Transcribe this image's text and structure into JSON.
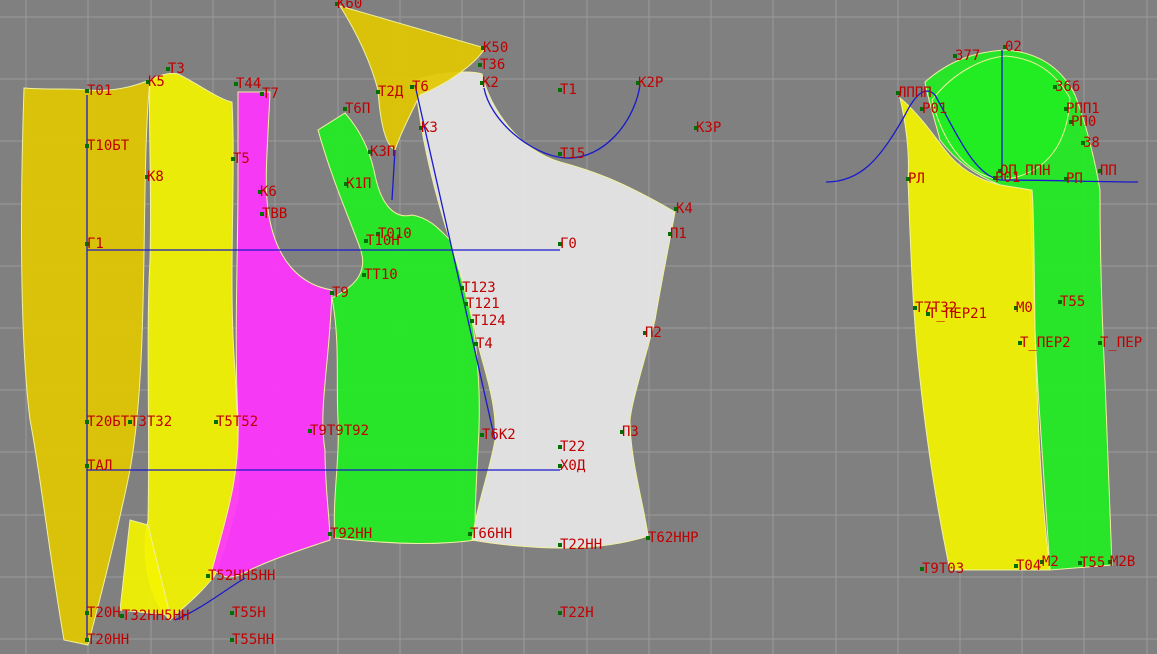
{
  "colors": {
    "background": "#808080",
    "grid": "#9a9a9a",
    "yellow_piece": "#e2c800",
    "bright_yellow_piece": "#f4f400",
    "magenta_piece": "#ff33ff",
    "green_piece": "#22ee22",
    "white_piece": "#e8e8e8",
    "label": "#c00000",
    "point": "#007000",
    "guide_line": "#1a1acc"
  },
  "pieces": [
    {
      "name": "side-back-panel",
      "color": "yellow_piece"
    },
    {
      "name": "back-panel",
      "color": "bright_yellow_piece"
    },
    {
      "name": "side-panel",
      "color": "magenta_piece"
    },
    {
      "name": "front-side-panel",
      "color": "green_piece"
    },
    {
      "name": "front-panel",
      "color": "white_piece"
    },
    {
      "name": "shoulder-yoke",
      "color": "yellow_piece"
    },
    {
      "name": "sleeve-under",
      "color": "bright_yellow_piece"
    },
    {
      "name": "sleeve-upper",
      "color": "green_piece"
    }
  ],
  "labels": [
    "К60",
    "К50",
    "Т36",
    "Т6",
    "К2",
    "Т1",
    "К2Р",
    "К3Р",
    "Т01",
    "К5",
    "Т3",
    "Т44",
    "Т7",
    "Т6П",
    "Т2Д",
    "К3",
    "К3П",
    "Т15",
    "К4",
    "Т10БТ",
    "Т5",
    "К8",
    "К6",
    "ТВВ",
    "К1П",
    "Т010",
    "Т10Н",
    "Г1",
    "Г0",
    "П1",
    "ТТ10",
    "Т9",
    "Т123",
    "Т121",
    "Т124",
    "Т4",
    "П2",
    "Т20БТ",
    "Т3Т32",
    "Т5Т52",
    "Т9Т9Т92",
    "Т6К2",
    "П3",
    "Т22",
    "ТАЛ",
    "Х0Д",
    "Т92НН",
    "Т66НН",
    "Т22НН",
    "Т62ННР",
    "Т52НН5НН",
    "Т20Н",
    "Т32НН5НН",
    "Т55Н",
    "Т22Н",
    "Т20НН",
    "Т55НН",
    "377",
    "02",
    "ЛППП",
    "Р01",
    "366",
    "РПП1",
    "РП0",
    "38",
    "РЛ",
    "ОП ППН",
    "Р01",
    "РП",
    "ПП",
    "Т7Т32",
    "Т_ПЕР21",
    "М0",
    "Т55",
    "Т_ПЕР2",
    "Т_ПЕР",
    "Т9Т03",
    "Т04",
    "М2",
    "Т55",
    "М2В"
  ]
}
